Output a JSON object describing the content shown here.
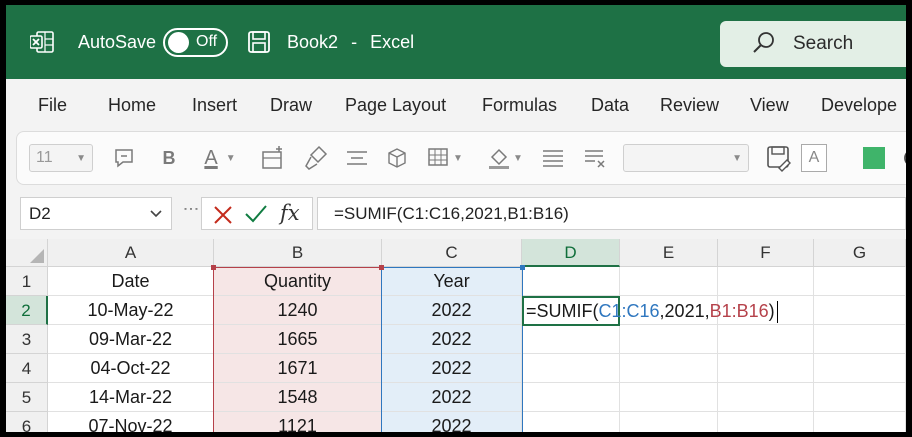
{
  "titlebar": {
    "autosave_label": "AutoSave",
    "toggle_state": "Off",
    "workbook": "Book2",
    "separator": "-",
    "app": "Excel",
    "search_placeholder": "Search",
    "brand_color": "#1e7145"
  },
  "tabs": [
    "File",
    "Home",
    "Insert",
    "Draw",
    "Page Layout",
    "Formulas",
    "Data",
    "Review",
    "View",
    "Develope"
  ],
  "toolbar": {
    "font_size": "11",
    "bold": "B",
    "font_color_glyph": "A",
    "style_glyph": "A"
  },
  "formula_bar": {
    "name_box": "D2",
    "fx": "fx",
    "formula": "=SUMIF(C1:C16,2021,B1:B16)"
  },
  "grid": {
    "columns": [
      "A",
      "B",
      "C",
      "D",
      "E",
      "F",
      "G"
    ],
    "active_column": "D",
    "rows": [
      "1",
      "2",
      "3",
      "4",
      "5",
      "6"
    ],
    "active_row": "2",
    "headers": {
      "A": "Date",
      "B": "Quantity",
      "C": "Year"
    },
    "data": [
      {
        "date": "10-May-22",
        "qty": "1240",
        "year": "2022"
      },
      {
        "date": "09-Mar-22",
        "qty": "1665",
        "year": "2022"
      },
      {
        "date": "04-Oct-22",
        "qty": "1671",
        "year": "2022"
      },
      {
        "date": "14-Mar-22",
        "qty": "1548",
        "year": "2022"
      },
      {
        "date": "07-Nov-22",
        "qty": "1121",
        "year": "2022"
      }
    ],
    "edit": {
      "prefix": "=SUMIF(",
      "ref_c": "C1:C16",
      "middle": ",2021,",
      "ref_b": "B1:B16",
      "suffix": ")"
    },
    "ref_colors": {
      "b": "#b5414a",
      "c": "#2f77bf"
    }
  }
}
